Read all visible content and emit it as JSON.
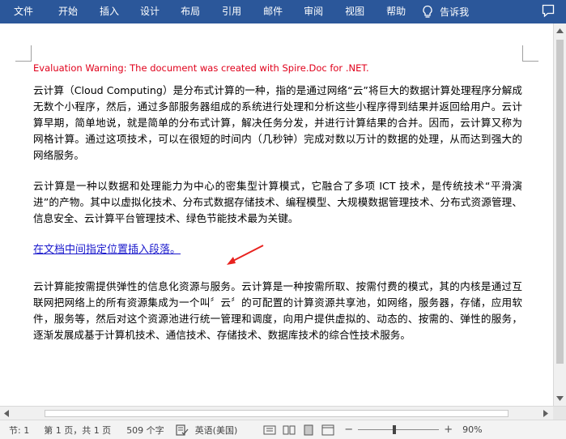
{
  "ribbon": {
    "tabs": [
      "文件",
      "开始",
      "插入",
      "设计",
      "布局",
      "引用",
      "邮件",
      "审阅",
      "视图",
      "帮助"
    ],
    "tell_me": "告诉我",
    "colors": {
      "background": "#2b579a",
      "text": "#ffffff"
    }
  },
  "document": {
    "warning": "Evaluation Warning: The document was created with Spire.Doc for .NET.",
    "paragraph1": "云计算（Cloud Computing）是分布式计算的一种，指的是通过网络“云”将巨大的数据计算处理程序分解成无数个小程序，然后，通过多部服务器组成的系统进行处理和分析这些小程序得到结果并返回给用户。云计算早期，简单地说，就是简单的分布式计算，解决任务分发，并进行计算结果的合并。因而，云计算又称为网格计算。通过这项技术，可以在很短的时间内（几秒钟）完成对数以万计的数据的处理，从而达到强大的网络服务。",
    "paragraph2": " 云计算是一种以数据和处理能力为中心的密集型计算模式，它融合了多项 ICT 技术，是传统技术“平滑演进”的产物。其中以虚拟化技术、分布式数据存储技术、编程模型、大规模数据管理技术、分布式资源管理、信息安全、云计算平台管理技术、绿色节能技术最为关键。",
    "inserted_link": "在文档中间指定位置插入段落。",
    "paragraph3": "云计算能按需提供弹性的信息化资源与服务。云计算是一种按需所取、按需付费的模式，其的内核是通过互联网把网络上的所有资源集成为一个叫〞云〞的可配置的计算资源共享池，如网络，服务器，存储，应用软件，服务等，然后对这个资源池进行统一管理和调度，向用户提供虚拟的、动态的、按需的、弹性的服务，逐渐发展成基于计算机技术、通信技术、存储技术、数据库技术的综合性技术服务。",
    "colors": {
      "warning": "#e0001b",
      "link": "#1a19cc",
      "arrow": "#e8231f"
    }
  },
  "status": {
    "section": "节: 1",
    "page": "第 1 页，共 1 页",
    "words": "509 个字",
    "language": "英语(美国)",
    "zoom_percent": "90%",
    "zoom_level": 0.9
  }
}
